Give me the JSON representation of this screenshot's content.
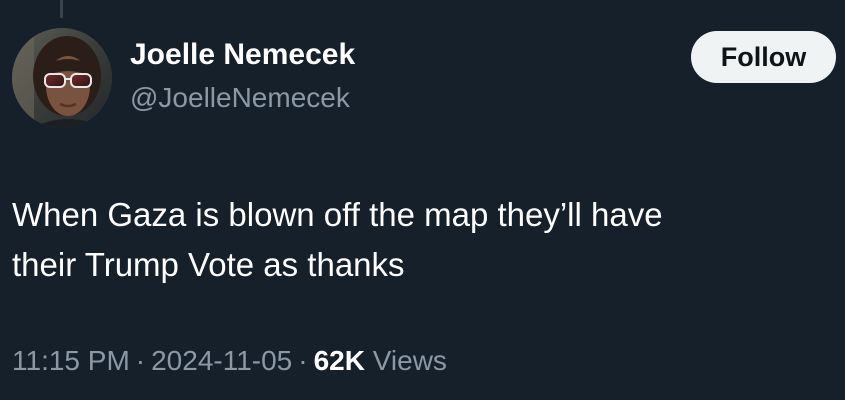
{
  "tweet": {
    "author": {
      "display_name": "Joelle Nemecek",
      "handle": "@JoelleNemecek"
    },
    "follow_label": "Follow",
    "text_lines": [
      "When Gaza is blown off the map they’ll have",
      "their Trump Vote as thanks"
    ],
    "meta": {
      "time": "11:15 PM",
      "separator": "·",
      "date": "2024-11-05",
      "views_count": "62K",
      "views_label": "Views"
    }
  },
  "colors": {
    "background": "#15202b",
    "primary_text": "#ffffff",
    "secondary_text": "#8b98a5",
    "follow_button_bg": "#eff3f4",
    "follow_button_text": "#0f1419"
  },
  "icons": {
    "avatar": "profile-photo-woman-sunglasses"
  }
}
